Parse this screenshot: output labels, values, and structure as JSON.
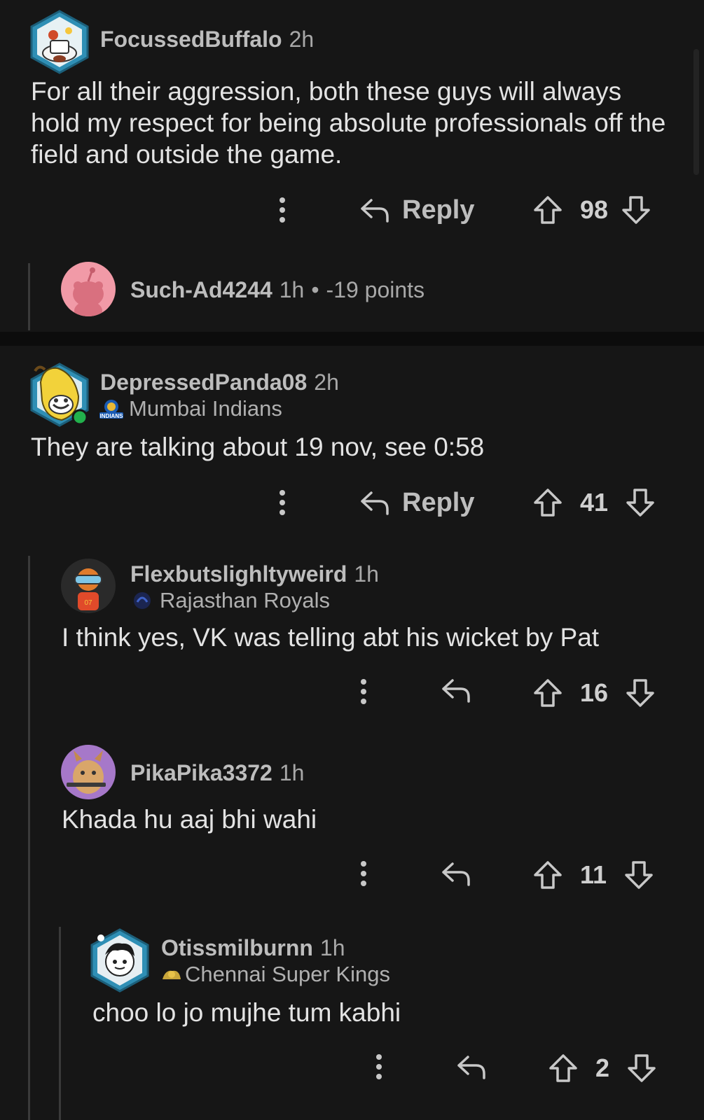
{
  "comments": [
    {
      "username": "FocussedBuffalo",
      "time": "2h",
      "body": "For all their aggression, both these guys will always hold my respect for being absolute professionals off the field and outside the game.",
      "reply_label": "Reply",
      "votes": "98"
    },
    {
      "username": "Such-Ad4244",
      "time": "1h",
      "separator": "•",
      "points": "-19 points"
    },
    {
      "username": "DepressedPanda08",
      "time": "2h",
      "flair": "Mumbai Indians",
      "flair_badge_text": "INDIANS",
      "body": "They are talking about 19 nov, see 0:58",
      "reply_label": "Reply",
      "votes": "41"
    },
    {
      "username": "Flexbutslighltyweird",
      "time": "1h",
      "flair": "Rajasthan Royals",
      "body": "I think yes, VK was telling abt his wicket by Pat",
      "votes": "16"
    },
    {
      "username": "PikaPika3372",
      "time": "1h",
      "body": "Khada hu aaj bhi wahi",
      "votes": "11"
    },
    {
      "username": "Otissmilburnn",
      "time": "1h",
      "flair": "Chennai Super Kings",
      "body": "choo lo jo mujhe tum kabhi",
      "votes": "2"
    }
  ],
  "colors": {
    "background": "#161616",
    "divider": "#0c0c0c",
    "thread_line": "#3a3a3a",
    "online": "#22b14c"
  },
  "icons": [
    "more-vertical-icon",
    "reply-arrow-icon",
    "upvote-icon",
    "downvote-icon"
  ]
}
